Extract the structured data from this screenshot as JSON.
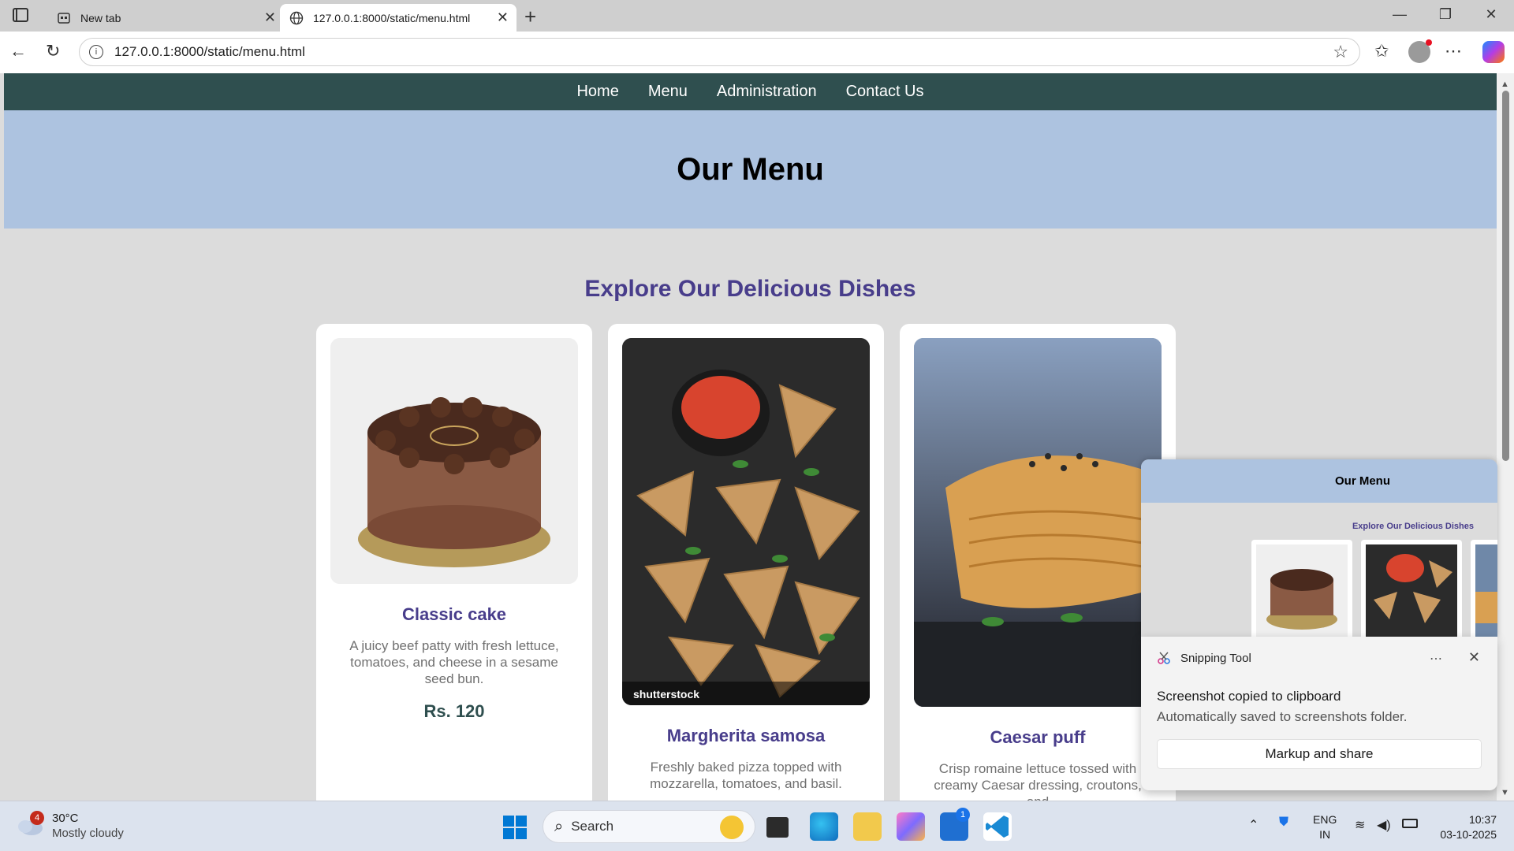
{
  "browser": {
    "tabs": [
      {
        "label": "New tab"
      },
      {
        "label": "127.0.0.1:8000/static/menu.html"
      }
    ],
    "url": "127.0.0.1:8000/static/menu.html"
  },
  "site": {
    "nav": [
      "Home",
      "Menu",
      "Administration",
      "Contact Us"
    ],
    "hero_title": "Our Menu",
    "section_title": "Explore Our Delicious Dishes",
    "cards": [
      {
        "name": "Classic cake",
        "description": "A juicy beef patty with fresh lettuce, tomatoes, and cheese in a sesame seed bun.",
        "price": "Rs. 120"
      },
      {
        "name": "Margherita samosa",
        "description": "Freshly baked pizza topped with mozzarella, tomatoes, and basil.",
        "price": ""
      },
      {
        "name": "Caesar puff",
        "description": "Crisp romaine lettuce tossed with creamy Caesar dressing, croutons, and",
        "price": ""
      }
    ],
    "watermark": "shutterstock"
  },
  "snip_preview": {
    "hero_title": "Our Menu",
    "section_title": "Explore Our Delicious Dishes"
  },
  "toast": {
    "app_name": "Snipping Tool",
    "title": "Screenshot copied to clipboard",
    "body": "Automatically saved to screenshots folder.",
    "action": "Markup and share"
  },
  "taskbar": {
    "weather_temp": "30°C",
    "weather_condition": "Mostly cloudy",
    "weather_badge": "4",
    "search_placeholder": "Search",
    "store_badge": "1",
    "lang_line1": "ENG",
    "lang_line2": "IN",
    "time": "10:37",
    "date": "03-10-2025"
  },
  "colors": {
    "nav_bg": "#2f4f4f",
    "hero_bg": "#adc3e0",
    "accent": "#483d8b"
  }
}
